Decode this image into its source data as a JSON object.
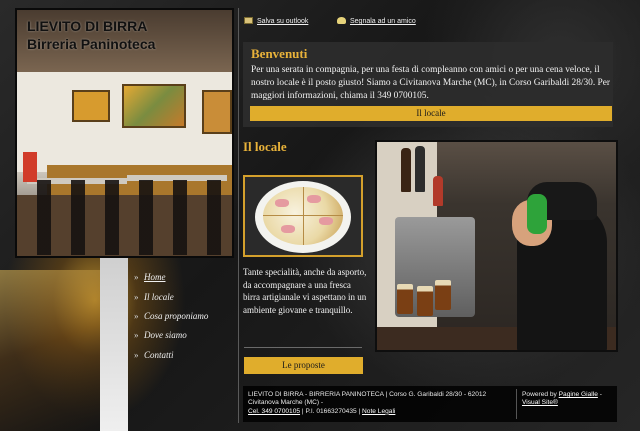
{
  "brand": {
    "line1": "LIEVITO DI BIRRA",
    "line2": "Birreria Paninoteca"
  },
  "top_links": {
    "save_outlook": "Salva su outlook",
    "tell_friend": "Segnala ad un amico"
  },
  "welcome": {
    "title": "Benvenuti",
    "text": "Per una serata in compagnia, per una festa di compleanno con amici o per una cena veloce, il nostro locale è il posto giusto! Siamo a Civitanova Marche (MC), in Corso Garibaldi 28/30. Per maggiori informazioni, chiama il 349 0700105.",
    "button": "Il locale"
  },
  "locale": {
    "title": "Il locale",
    "description": "Tante specialità, anche da asporto, da accompagnare a una fresca birra artigianale vi aspettano in un ambiente giovane e tranquillo.",
    "button": "Le proposte"
  },
  "nav": {
    "items": [
      {
        "label": "Home",
        "active": true
      },
      {
        "label": "Il locale",
        "active": false
      },
      {
        "label": "Cosa proponiamo",
        "active": false
      },
      {
        "label": "Dove siamo",
        "active": false
      },
      {
        "label": "Contatti",
        "active": false
      }
    ],
    "bullet": "»"
  },
  "footer": {
    "address": "LIEVITO DI BIRRA - BIRRERIA PANINOTECA | Corso G. Garibaldi 28/30 - 62012 Civitanova Marche (MC) -",
    "phone_link": "Cel. 349 0700105",
    "vat": " | P.I. 01663270435 | ",
    "legal_link": "Note Legali",
    "powered_prefix": "Powered by ",
    "powered_link": "Pagine Gialle",
    "powered_sep": " - ",
    "visual_link": "Visual Site®"
  },
  "colors": {
    "accent_gold": "#e0ad2c",
    "title_gold": "#e8b23a",
    "panel": "#2d2d2d",
    "footer_bg": "#000000"
  }
}
